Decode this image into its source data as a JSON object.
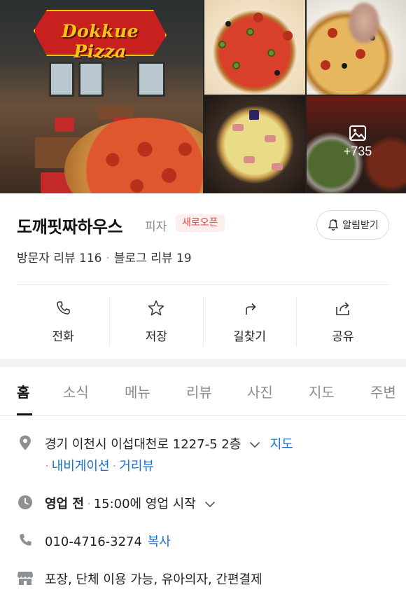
{
  "gallery": {
    "logo_text": "Dokkue Pizza",
    "more_photos": "+735"
  },
  "place": {
    "name": "도깨핏짜하우스",
    "category": "피자",
    "badge": "새로오픈",
    "notify_label": "알림받기"
  },
  "reviews": {
    "visitor": "방문자 리뷰 116",
    "blog": "블로그 리뷰 19"
  },
  "actions": [
    {
      "label": "전화",
      "icon": "phone-icon"
    },
    {
      "label": "저장",
      "icon": "star-icon"
    },
    {
      "label": "길찾기",
      "icon": "directions-icon"
    },
    {
      "label": "공유",
      "icon": "share-icon"
    }
  ],
  "tabs": [
    "홈",
    "소식",
    "메뉴",
    "리뷰",
    "사진",
    "지도",
    "주변"
  ],
  "info": {
    "address": "경기 이천시 이섭대천로 1227-5 2층",
    "map_link": "지도",
    "navigation_link": "내비게이션",
    "street_view_link": "거리뷰",
    "hours_status": "영업 전",
    "hours_detail": "15:00에 영업 시작",
    "phone": "010-4716-3274",
    "copy_label": "복사",
    "amenities": "포장, 단체 이용 가능, 유아의자, 간편결제"
  },
  "colors": {
    "link": "#1b6fd3",
    "badge_bg": "#fdeeee",
    "badge_text": "#e5484d",
    "icon_gray": "#8e9194"
  }
}
